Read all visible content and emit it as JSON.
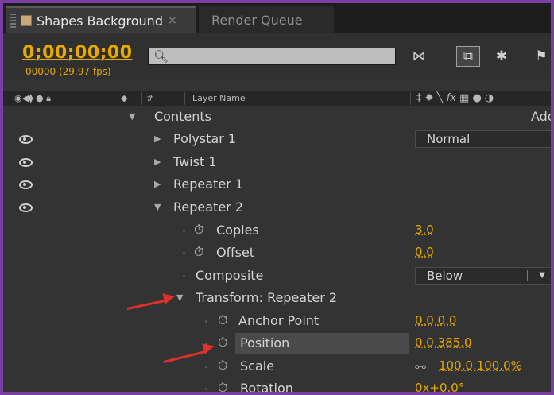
{
  "tabs": [
    {
      "label": "Shapes Background",
      "close": "×"
    },
    {
      "label": "Render Queue"
    }
  ],
  "toolbar": {
    "timecode": "0;00;00;00",
    "fps": "00000 (29.97 fps)",
    "search_placeholder": ""
  },
  "header": {
    "layer_name": "Layer Name",
    "hash": "#",
    "right_label": "Add"
  },
  "rows": {
    "contents": "Contents",
    "polystar": "Polystar 1",
    "polystar_mode": "Normal",
    "twist": "Twist 1",
    "repeater1": "Repeater 1",
    "repeater2": "Repeater 2",
    "copies_label": "Copies",
    "copies_value": "3.0",
    "offset_label": "Offset",
    "offset_value": "0.0",
    "composite_label": "Composite",
    "composite_value": "Below",
    "transform_label": "Transform: Repeater 2",
    "anchor_label": "Anchor Point",
    "anchor_value": "0.0,0.0",
    "position_label": "Position",
    "position_value": "0.0,385.0",
    "scale_label": "Scale",
    "scale_value": "100.0,100.0%",
    "rotation_label": "Rotation",
    "rotation_value": "0x+0.0°"
  },
  "colors": {
    "accent": "#e8a900",
    "annotation_arrow": "#e0302a",
    "panel": "#333333",
    "border": "#7a3fa0"
  },
  "icons": [
    "eye-icon",
    "stopwatch-icon",
    "search-icon",
    "link-icon",
    "triangle-icon"
  ]
}
